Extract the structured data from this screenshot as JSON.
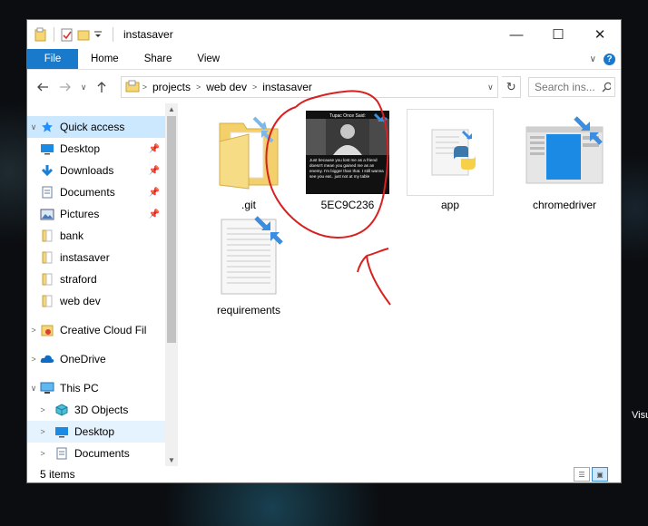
{
  "window": {
    "title": "instasaver"
  },
  "controls": {
    "minimize": "—",
    "maximize": "☐",
    "close": "✕"
  },
  "ribbon": {
    "tabs": [
      "File",
      "Home",
      "Share",
      "View"
    ]
  },
  "address": {
    "crumbs": [
      "projects",
      "web dev",
      "instasaver"
    ]
  },
  "search": {
    "placeholder": "Search ins..."
  },
  "nav": {
    "items": [
      {
        "label": "Quick access",
        "icon": "star-icon",
        "expand": "∨",
        "state": "selected"
      },
      {
        "label": "Desktop",
        "icon": "desktop-icon",
        "pinned": true
      },
      {
        "label": "Downloads",
        "icon": "download-icon",
        "pinned": true
      },
      {
        "label": "Documents",
        "icon": "document-icon",
        "pinned": true
      },
      {
        "label": "Pictures",
        "icon": "picture-icon",
        "pinned": true
      },
      {
        "label": "bank",
        "icon": "folder-icon"
      },
      {
        "label": "instasaver",
        "icon": "folder-icon"
      },
      {
        "label": "straford",
        "icon": "folder-icon"
      },
      {
        "label": "web dev",
        "icon": "folder-icon"
      },
      {
        "label": "Creative Cloud Fil",
        "icon": "creative-cloud-icon",
        "expand": ">"
      },
      {
        "label": "OneDrive",
        "icon": "onedrive-icon",
        "expand": ">"
      },
      {
        "label": "This PC",
        "icon": "computer-icon",
        "expand": "∨"
      },
      {
        "label": "3D Objects",
        "icon": "cube-icon",
        "expand": ">"
      },
      {
        "label": "Desktop",
        "icon": "desktop-icon",
        "expand": ">",
        "state": "highlight"
      },
      {
        "label": "Documents",
        "icon": "document-icon",
        "expand": ">"
      }
    ]
  },
  "files": [
    {
      "name": ".git",
      "type": "folder"
    },
    {
      "name": "5EC9C236",
      "type": "image"
    },
    {
      "name": "app",
      "type": "python"
    },
    {
      "name": "chromedriver",
      "type": "executable"
    },
    {
      "name": "requirements",
      "type": "text"
    }
  ],
  "meme": {
    "header": "Tupac Once Said:",
    "caption": "Just because you lost me as a friend doesn't mean you gained me as an enemy. I'm bigger than that. I still wanna see you eat.. just not at my table"
  },
  "status": {
    "count": "5 items"
  },
  "desktop_text": "Visu",
  "colors": {
    "accent": "#1979ca",
    "selected": "#cce8ff",
    "annotation": "#d92020"
  }
}
